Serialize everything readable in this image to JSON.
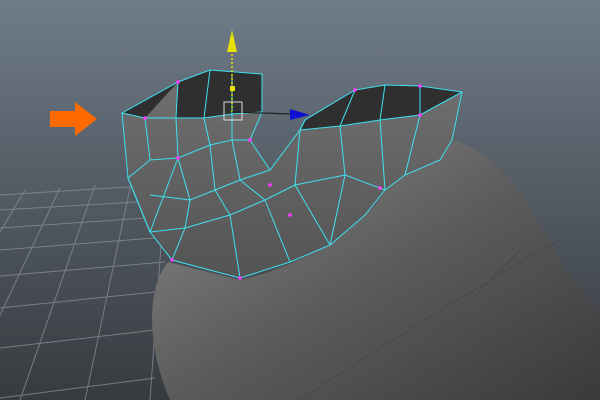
{
  "viewport": {
    "background_top": "#6f7c89",
    "background_bottom": "#373b40",
    "grid_color": "#8a9096",
    "mesh_wire_color": "#3fe0f0",
    "vertex_color": "#ff3cff",
    "object_color": "#707070",
    "pointer_arrow_color": "#ff6a00",
    "manip_y_color": "#e8e000",
    "manip_x_color": "#1010d0"
  }
}
